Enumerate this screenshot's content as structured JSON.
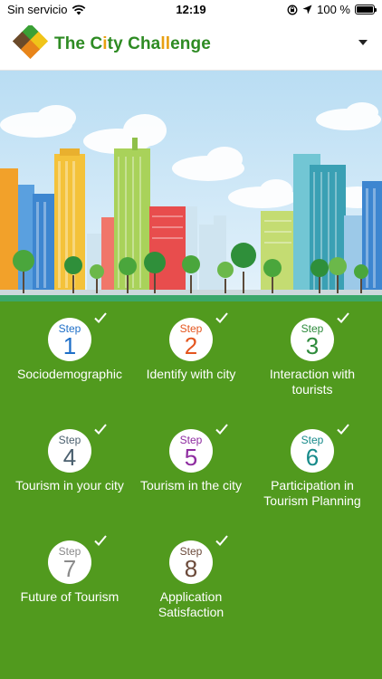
{
  "status_bar": {
    "carrier": "Sin servicio",
    "time": "12:19",
    "battery": "100 %",
    "icons": [
      "wifi-icon",
      "rotation-lock-icon",
      "location-arrow-icon",
      "battery-icon"
    ]
  },
  "header": {
    "title_part1": "The C",
    "title_part2": "i",
    "title_part3": "ty Cha",
    "title_part4": "ll",
    "title_part5": "enge",
    "menu_icon": "chevron-down-icon"
  },
  "colors": {
    "background_green": "#519a1e",
    "title_green": "#2e8b23",
    "title_orange": "#e8a011"
  },
  "steps": [
    {
      "word": "Step",
      "number": "1",
      "label": "Sociodemographic",
      "color": "#1e6fc8",
      "completed": true
    },
    {
      "word": "Step",
      "number": "2",
      "label": "Identify with city",
      "color": "#e4551e",
      "completed": true
    },
    {
      "word": "Step",
      "number": "3",
      "label": "Interaction with tourists",
      "color": "#2e8b3c",
      "completed": true
    },
    {
      "word": "Step",
      "number": "4",
      "label": "Tourism in your city",
      "color": "#4a5f6e",
      "completed": true
    },
    {
      "word": "Step",
      "number": "5",
      "label": "Tourism in the city",
      "color": "#8e2ca0",
      "completed": true
    },
    {
      "word": "Step",
      "number": "6",
      "label": "Participation in Tourism Planning",
      "color": "#168a8a",
      "completed": true
    },
    {
      "word": "Step",
      "number": "7",
      "label": "Future of Tourism",
      "color": "#8a8a8a",
      "completed": true
    },
    {
      "word": "Step",
      "number": "8",
      "label": "Application Satisfaction",
      "color": "#6b4a3a",
      "completed": true
    }
  ]
}
